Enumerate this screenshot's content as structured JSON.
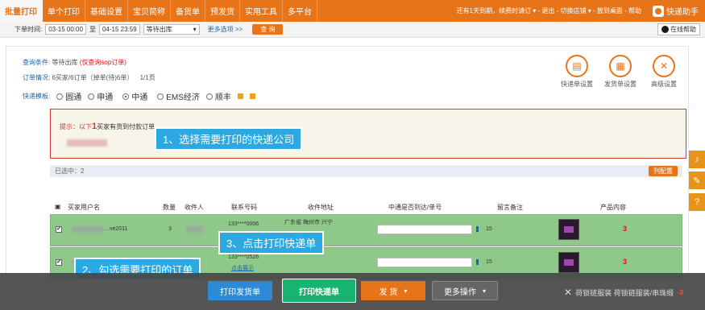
{
  "nav": {
    "tabs": [
      "批量打印",
      "单个打印",
      "基础设置",
      "宝贝简称",
      "备货单",
      "预发货",
      "实用工具",
      "多平台"
    ],
    "right_text": "还有1天到期，续费时请订 ▾ - 退出 - 切换店铺 ▾ - 放到桌面 - 帮助",
    "helper": "快递助手"
  },
  "filter": {
    "label": "下单时间:",
    "date_from": "03-15 00:00",
    "to": "至",
    "date_to": "04-15 23:59",
    "status": "等待出库",
    "more": "更多选项 >>",
    "query": "查 询",
    "online_help": "在线帮助"
  },
  "conditions": {
    "query_label": "查询条件:",
    "query_value": "等待出库",
    "query_red": "(仅查询sop订单)",
    "order_label": "订单情况:",
    "order_value": "6买家/6订单（掉单(待)6单）",
    "order_pages": "1/1页"
  },
  "express": {
    "label": "快递模板:",
    "options": [
      "圆通",
      "申通",
      "中通",
      "EMS经济",
      "顺丰"
    ],
    "selected": "中通"
  },
  "tools": [
    "快递单设置",
    "发货单设置",
    "高级设置"
  ],
  "hint": {
    "prefix": "提示：以下",
    "count": "1",
    "suffix": "买家有货到付款订单"
  },
  "selected": {
    "text": "已选中：2",
    "columns_btn": "列配置"
  },
  "table": {
    "headers": [
      "买家用户名",
      "数量",
      "收件人",
      "联系号码",
      "收件地址",
      "中通是否到达/单号",
      "留言备注",
      "产品内容"
    ],
    "rows": [
      {
        "buyer": "…ve2011",
        "qty": "3",
        "phone": "133****0006",
        "addr": "广东省 梅州市 兴宁",
        "note": "15",
        "red": "3"
      },
      {
        "buyer": "…",
        "qty": "",
        "phone": "133****0526",
        "addr": "点击展示",
        "note": "15",
        "red": "3"
      }
    ]
  },
  "callouts": {
    "c1": "1、选择需要打印的快递公司",
    "c2": "2、勾选需要打印的订单",
    "c3": "3、点击打印快递单"
  },
  "actions": {
    "print_delivery": "打印发货单",
    "print_express": "打印快递单",
    "ship": "发 货",
    "more": "更多操作",
    "right_text": "荷锁链服装 荷锁链服装/串珠缎",
    "right_num": "-3"
  },
  "colors": {
    "brand": "#e8741a",
    "row_selected": "#8fc98a",
    "callout": "#2ea8e0",
    "print_btn": "#16b46e"
  }
}
